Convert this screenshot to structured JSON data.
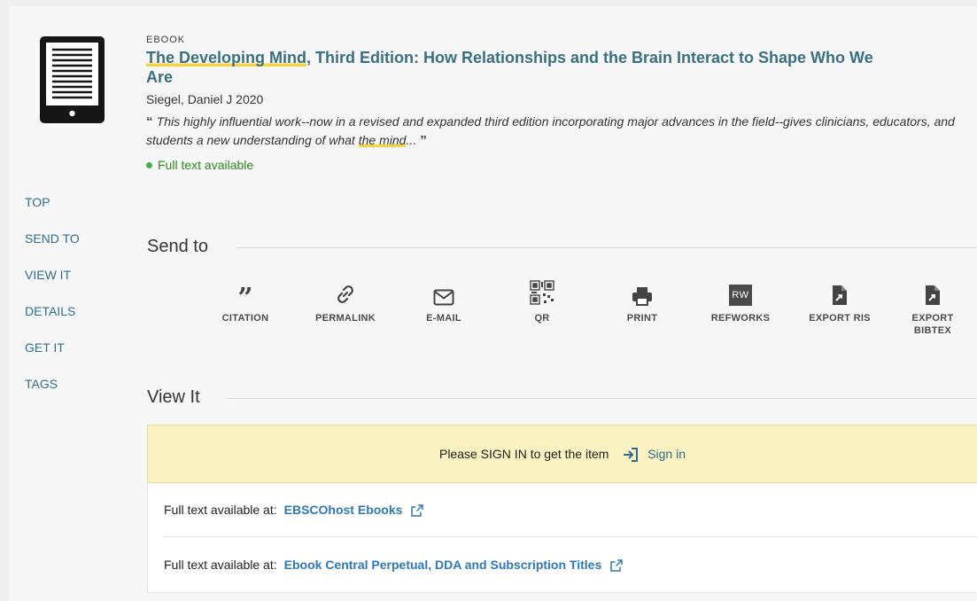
{
  "record": {
    "type": "EBOOK",
    "title_part1": "The Developing Mind",
    "title_part2": ", Third Edition: How Relationships and the Brain Interact to Shape Who We Are",
    "author_year": "Siegel, Daniel J 2020",
    "snippet_part1": "This highly influential work--now in a revised and expanded third edition incorporating major advances in the field--gives clinicians, educators, and students a new understanding of what ",
    "snippet_highlight": "the mind",
    "snippet_end": "...",
    "availability": "Full text available"
  },
  "nav": [
    "TOP",
    "SEND TO",
    "VIEW IT",
    "DETAILS",
    "GET IT",
    "TAGS"
  ],
  "send_to": {
    "title": "Send to",
    "actions": [
      {
        "label": "CITATION",
        "icon": "quote-icon"
      },
      {
        "label": "PERMALINK",
        "icon": "link-icon"
      },
      {
        "label": "E-MAIL",
        "icon": "envelope-icon"
      },
      {
        "label": "QR",
        "icon": "qr-code-icon"
      },
      {
        "label": "PRINT",
        "icon": "printer-icon"
      },
      {
        "label": "REFWORKS",
        "icon": "refworks-icon",
        "badge": "RW"
      },
      {
        "label": "EXPORT RIS",
        "icon": "file-export-icon"
      },
      {
        "label": "EXPORT BIBTEX",
        "icon": "file-export-icon"
      }
    ]
  },
  "view_it": {
    "title": "View It",
    "signin_message": "Please SIGN IN to get the item",
    "signin_link": "Sign in",
    "links": [
      {
        "prefix": "Full text available at:",
        "source": "EBSCOhost Ebooks"
      },
      {
        "prefix": "Full text available at:",
        "source": "Ebook Central Perpetual, DDA and Subscription Titles"
      }
    ]
  },
  "colors": {
    "title": "#3a6f82",
    "link": "#2f6c8f",
    "available": "#2b8a1c",
    "highlight": "#f5d33c",
    "signin_bg": "#fbf2c2"
  }
}
